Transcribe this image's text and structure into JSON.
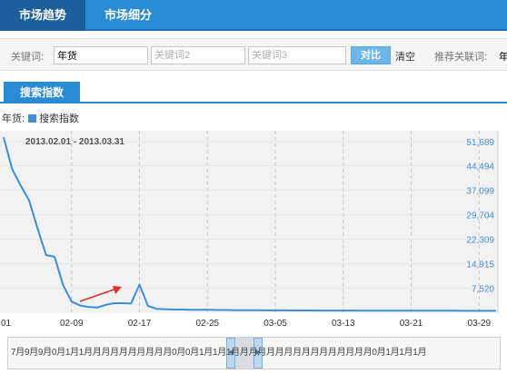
{
  "nav": {
    "tabs": [
      {
        "label": "市场趋势",
        "active": true
      },
      {
        "label": "市场细分",
        "active": false
      }
    ]
  },
  "filter": {
    "keyword_label": "关键词:",
    "keyword1_value": "年货",
    "keyword2_placeholder": "关键词2",
    "keyword3_placeholder": "关键词3",
    "compare_label": "对比",
    "clear_label": "清空",
    "recommend_label": "推荐关联词:",
    "recommend_value": "年"
  },
  "section": {
    "tab_label": "搜索指数"
  },
  "legend": {
    "keyword": "年货:",
    "series": "搜索指数"
  },
  "colors": {
    "accent": "#2a8bd5",
    "series": "#3d8ed6",
    "arrow": "#e32d2d"
  },
  "chart_data": {
    "type": "line",
    "date_range": "2013.02.01 - 2013.03.31",
    "y_ticks": [
      "51,689",
      "44,494",
      "37,099",
      "29,704",
      "22,309",
      "14,915",
      "7,520"
    ],
    "x_ticks": [
      "01",
      "02-09",
      "02-17",
      "02-25",
      "03-05",
      "03-13",
      "03-21",
      "03-29"
    ],
    "ylim": [
      0,
      55000
    ],
    "x": [
      "02-01",
      "02-02",
      "02-03",
      "02-04",
      "02-05",
      "02-06",
      "02-07",
      "02-08",
      "02-09",
      "02-10",
      "02-11",
      "02-12",
      "02-13",
      "02-14",
      "02-15",
      "02-16",
      "02-17",
      "02-18",
      "02-19",
      "02-20",
      "02-21",
      "02-22",
      "02-23",
      "02-24",
      "02-25",
      "02-26",
      "02-27",
      "02-28",
      "03-01",
      "03-02",
      "03-03",
      "03-04",
      "03-05",
      "03-06",
      "03-07",
      "03-08",
      "03-09",
      "03-10",
      "03-11",
      "03-12",
      "03-13",
      "03-14",
      "03-15",
      "03-16",
      "03-17",
      "03-18",
      "03-19",
      "03-20",
      "03-21",
      "03-22",
      "03-23",
      "03-24",
      "03-25",
      "03-26",
      "03-27",
      "03-28",
      "03-29",
      "03-30",
      "03-31"
    ],
    "values": [
      53000,
      43500,
      38500,
      34000,
      25500,
      17500,
      17000,
      8500,
      3500,
      2300,
      1900,
      1700,
      2500,
      3000,
      3000,
      2900,
      8600,
      2200,
      1300,
      1200,
      1100,
      1100,
      1000,
      1000,
      1000,
      950,
      950,
      900,
      900,
      900,
      880,
      860,
      850,
      850,
      830,
      820,
      810,
      800,
      800,
      790,
      780,
      780,
      770,
      770,
      760,
      760,
      760,
      750,
      750,
      740,
      740,
      740,
      730,
      730,
      720,
      720,
      720,
      710,
      700
    ]
  },
  "slider": {
    "month_text": "7月9月9月0月1月1月月月月月月月月月月0月0月1月1月1月月月月月月月月月月月月月月月月0月1月1月1月"
  }
}
